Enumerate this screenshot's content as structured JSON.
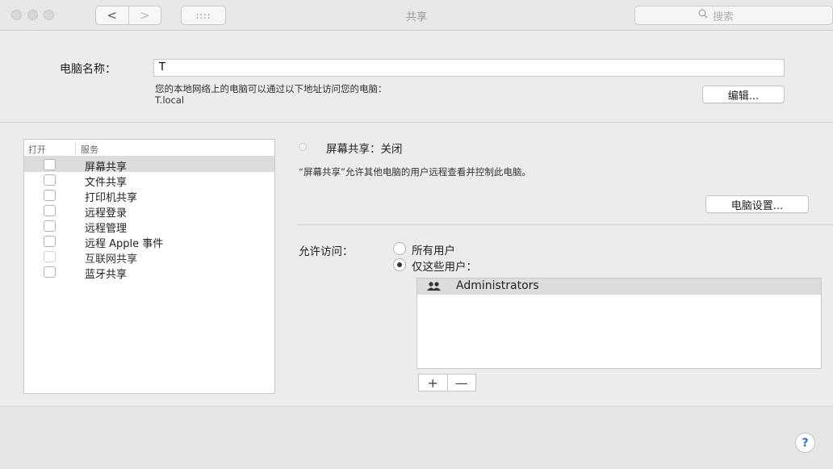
{
  "window": {
    "title": "共享",
    "nav_back": "<",
    "nav_forward": ">",
    "grid_glyph": "::::",
    "search_placeholder": "搜索",
    "search_icon": "magnifier-icon"
  },
  "computer_name": {
    "label": "电脑名称：",
    "value": "T",
    "info_line1": "您的本地网络上的电脑可以通过以下地址访问您的电脑：",
    "info_line2": "T.local",
    "edit_button": "编辑..."
  },
  "services": {
    "header_on": "打开",
    "header_service": "服务",
    "items": [
      {
        "label": "屏幕共享",
        "checked": false,
        "selected": true
      },
      {
        "label": "文件共享",
        "checked": false
      },
      {
        "label": "打印机共享",
        "checked": false
      },
      {
        "label": "远程登录",
        "checked": false
      },
      {
        "label": "远程管理",
        "checked": false
      },
      {
        "label": "远程 Apple 事件",
        "checked": false
      },
      {
        "label": "互联网共享",
        "checked": false,
        "disabled": true
      },
      {
        "label": "蓝牙共享",
        "checked": false
      }
    ]
  },
  "detail": {
    "status_title": "屏幕共享：关闭",
    "status_desc": "“屏幕共享”允许其他电脑的用户远程查看并控制此电脑。",
    "computer_settings_button": "电脑设置...",
    "access_label": "允许访问：",
    "radio_all": "所有用户",
    "radio_only": "仅这些用户：",
    "selected_access": "仅这些用户",
    "users": [
      {
        "name": "Administrators",
        "icon": "group-icon"
      }
    ],
    "add_label": "+",
    "remove_label": "—"
  },
  "help": {
    "label": "?"
  }
}
